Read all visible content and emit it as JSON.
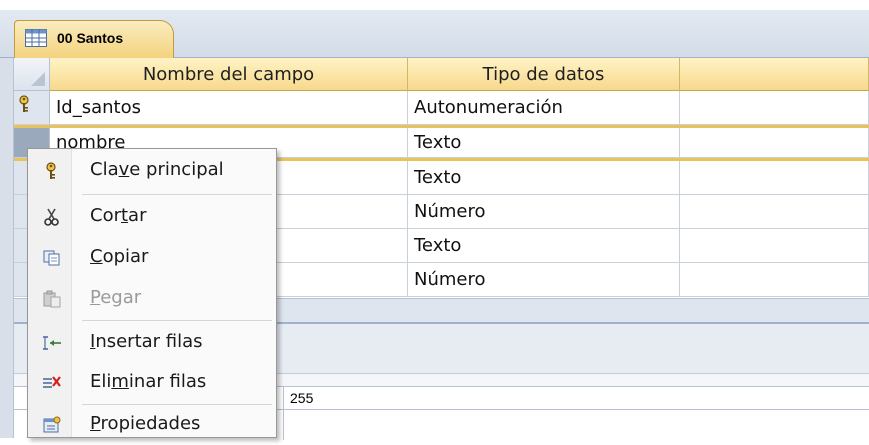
{
  "tab": {
    "label": "00 Santos",
    "icon": "table-icon"
  },
  "grid": {
    "headers": {
      "name": "Nombre del campo",
      "type": "Tipo de datos"
    },
    "rows": [
      {
        "name": "Id_santos",
        "type": "Autonumeración",
        "primary_key": true
      },
      {
        "name": "nombre",
        "type": "Texto",
        "selected": true
      },
      {
        "name": "",
        "type": "Texto"
      },
      {
        "name": "",
        "type": "Número"
      },
      {
        "name": "",
        "type": "Texto"
      },
      {
        "name": "",
        "type": "Número"
      }
    ]
  },
  "properties": {
    "field_size_value": "255"
  },
  "context_menu": {
    "items": [
      {
        "pre": "Cla",
        "acc": "v",
        "post": "e principal",
        "icon": "key-icon",
        "enabled": true
      },
      {
        "pre": "Cor",
        "acc": "t",
        "post": "ar",
        "icon": "scissors-icon",
        "enabled": true
      },
      {
        "pre": "",
        "acc": "C",
        "post": "opiar",
        "icon": "copy-icon",
        "enabled": true
      },
      {
        "pre": "",
        "acc": "P",
        "post": "egar",
        "icon": "paste-icon",
        "enabled": false
      },
      {
        "pre": "",
        "acc": "I",
        "post": "nsertar filas",
        "icon": "insert-rows-icon",
        "enabled": true
      },
      {
        "pre": "Eli",
        "acc": "m",
        "post": "inar filas",
        "icon": "delete-rows-icon",
        "enabled": true
      },
      {
        "pre": "",
        "acc": "P",
        "post": "ropiedades",
        "icon": "properties-icon",
        "enabled": true
      }
    ]
  },
  "colors": {
    "accent": "#e8c35a",
    "header_bg": "#f7d98c",
    "tab_bg": "#f3d27c",
    "chrome": "#d8dfe9"
  }
}
